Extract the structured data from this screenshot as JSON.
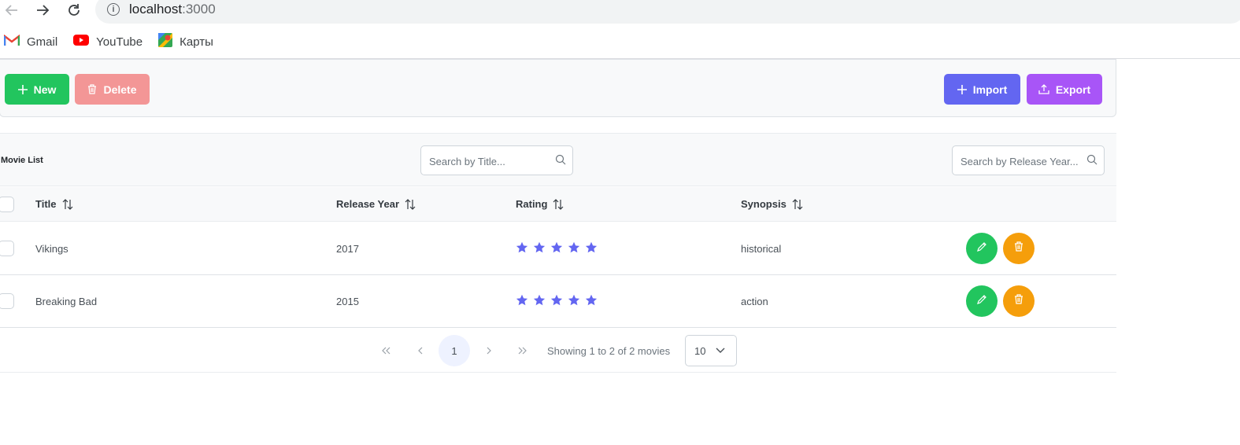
{
  "browser": {
    "url_host": "localhost",
    "url_port": ":3000",
    "bookmarks": [
      {
        "label": "Gmail",
        "icon": "gmail-icon"
      },
      {
        "label": "YouTube",
        "icon": "youtube-icon"
      },
      {
        "label": "Карты",
        "icon": "maps-icon"
      }
    ]
  },
  "toolbar": {
    "new_label": "New",
    "delete_label": "Delete",
    "import_label": "Import",
    "export_label": "Export",
    "colors": {
      "new": "#22c55e",
      "delete": "#f39696",
      "import": "#6366f1",
      "export": "#a855f7"
    }
  },
  "table": {
    "title": "Movie List",
    "search_title_placeholder": "Search by Title...",
    "search_year_placeholder": "Search by Release Year...",
    "columns": [
      "Title",
      "Release Year",
      "Rating",
      "Synopsis"
    ],
    "rows": [
      {
        "title": "Vikings",
        "year": "2017",
        "rating": 5,
        "synopsis": "historical"
      },
      {
        "title": "Breaking Bad",
        "year": "2015",
        "rating": 5,
        "synopsis": "action"
      }
    ],
    "star_color": "#6366f1",
    "edit_color": "#22c55e",
    "delete_color": "#f59e0b"
  },
  "paginator": {
    "current_page": "1",
    "report": "Showing 1 to 2 of 2 movies",
    "rows_per_page": "10"
  }
}
